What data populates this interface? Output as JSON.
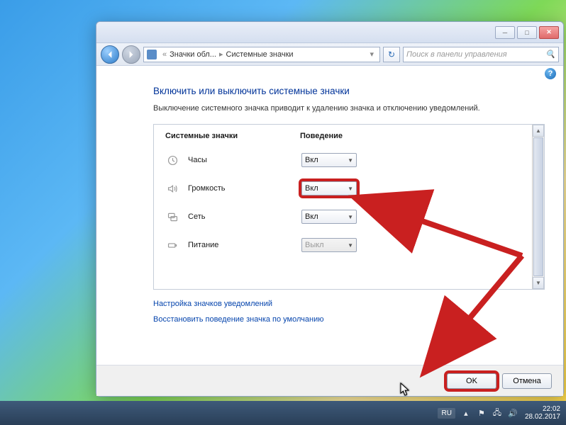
{
  "breadcrumb": {
    "part1": "Значки обл...",
    "part2": "Системные значки"
  },
  "search": {
    "placeholder": "Поиск в панели управления"
  },
  "heading": "Включить или выключить системные значки",
  "description": "Выключение системного значка приводит к удалению значка и отключению уведомлений.",
  "columns": {
    "icons": "Системные значки",
    "behavior": "Поведение"
  },
  "rows": {
    "clock": {
      "label": "Часы",
      "value": "Вкл"
    },
    "volume": {
      "label": "Громкость",
      "value": "Вкл"
    },
    "network": {
      "label": "Сеть",
      "value": "Вкл"
    },
    "power": {
      "label": "Питание",
      "value": "Выкл"
    }
  },
  "links": {
    "customize": "Настройка значков уведомлений",
    "restore": "Восстановить поведение значка по умолчанию"
  },
  "buttons": {
    "ok": "OK",
    "cancel": "Отмена"
  },
  "taskbar": {
    "lang": "RU",
    "time": "22:02",
    "date": "28.02.2017"
  },
  "annotation": {
    "highlight_color": "#c92020"
  }
}
